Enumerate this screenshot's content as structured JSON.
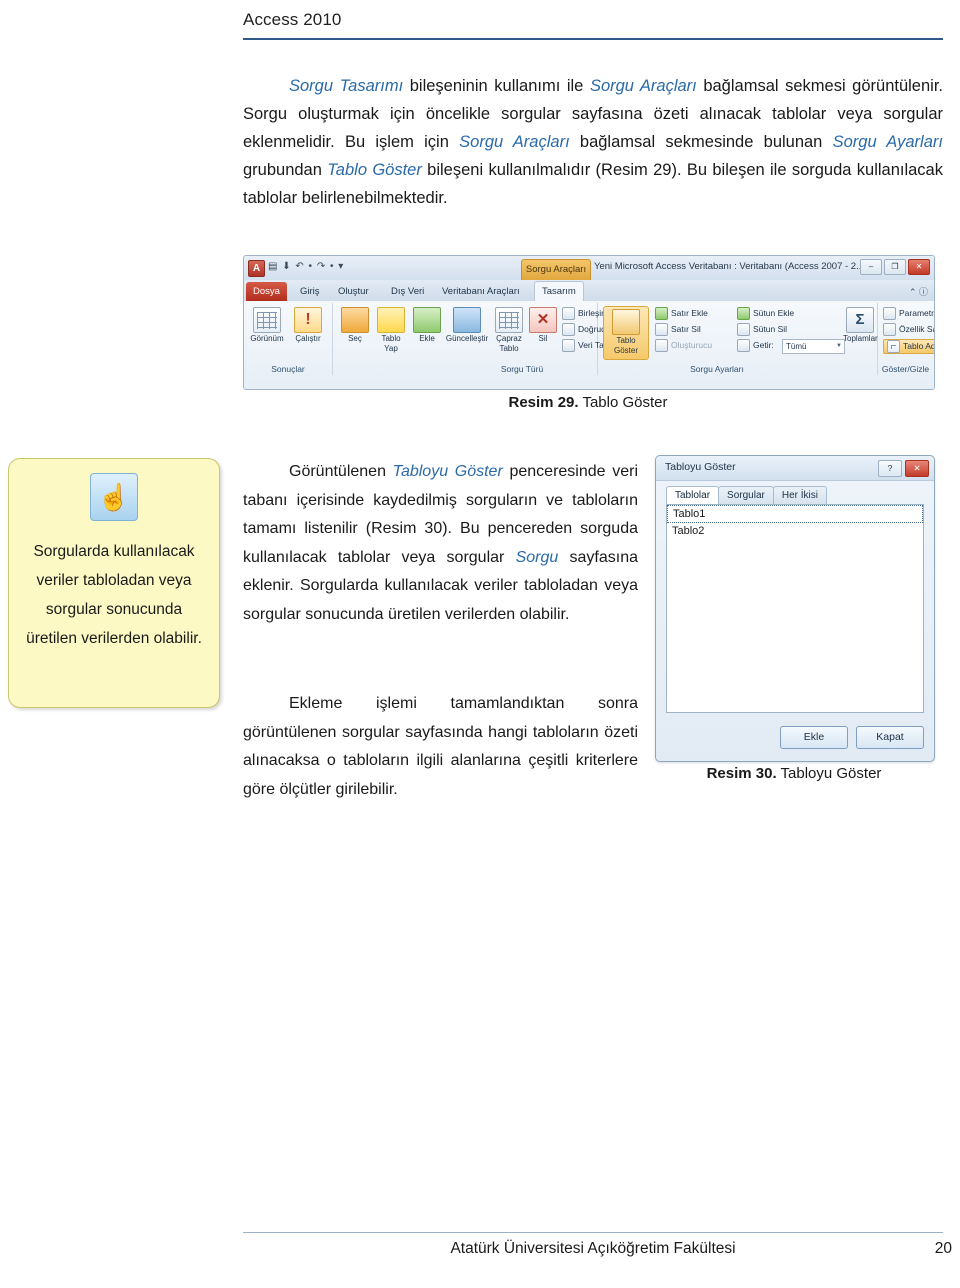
{
  "header": {
    "title": "Access 2010"
  },
  "body": {
    "p1_seg1": "Sorgu Tasarımı",
    "p1_seg2": " bileşeninin kullanımı ile ",
    "p1_seg3": "Sorgu Araçları",
    "p1_seg4": " bağlamsal sekmesi görüntülenir. Sorgu oluşturmak için öncelikle sorgular sayfasına özeti alınacak tablolar veya sorgular eklenmelidir. Bu işlem için ",
    "p1_seg5": "Sorgu Araçları",
    "p1_seg6": " bağlamsal sekmesinde bulunan ",
    "p1_seg7": "Sorgu Ayarları",
    "p1_seg8": " grubundan ",
    "p1_seg9": "Tablo Göster",
    "p1_seg10": " bileşeni kullanılmalıdır (Resim 29). Bu bileşen ile sorguda kullanılacak tablolar belirlenebilmektedir.",
    "p2_seg1": "Görüntülenen ",
    "p2_seg2": "Tabloyu Göster",
    "p2_seg3": " penceresinde veri tabanı içerisinde kaydedilmiş sorguların ve tabloların tamamı listenilir (Resim 30). Bu pencereden sorguda kullanılacak tablolar veya sorgular ",
    "p2_seg4": "Sorgu",
    "p2_seg5": " sayfasına eklenir. Sorgularda kullanılacak veriler tabloladan veya sorgular sonucunda üretilen verilerden olabilir.",
    "p3": "Ekleme işlemi tamamlandıktan sonra görüntülenen sorgular sayfasında hangi tabloların özeti alınacaksa o tabloların ilgili alanlarına çeşitli kriterlere göre ölçütler girilebilir."
  },
  "callout": {
    "icon": "hand-pointer-icon",
    "text": "Sorgularda kullanılacak veriler tabloladan veya sorgular sonucunda üretilen verilerden olabilir."
  },
  "figure29": {
    "caption_label": "Resim 29.",
    "caption_text": " Tablo Göster",
    "window": {
      "app_icon": "A",
      "quick_access": "▤ ⬇ ↶ • ↷ • ▾",
      "contextual_tab_group": "Sorgu Araçları",
      "doc_title": "Yeni Microsoft Access Veritabanı : Veritabanı (Access 2007 - 2...",
      "min": "–",
      "max": "❐",
      "close": "✕",
      "help": "⌃  ⓘ",
      "tabs": [
        "Dosya",
        "Giriş",
        "Oluştur",
        "Dış Veri",
        "Veritabanı Araçları",
        "Tasarım"
      ],
      "active_tab": "Tasarım",
      "groups": [
        {
          "label": "Sonuçlar",
          "buttons": [
            "Görünüm",
            "Çalıştır"
          ]
        },
        {
          "label": "Sorgu Türü",
          "buttons": [
            "Seç",
            "Tablo Yap",
            "Ekle",
            "Güncelleştir",
            "Çapraz Tablo",
            "Sil"
          ],
          "items": [
            "Birleşim",
            "Doğrudan",
            "Veri Tanımı"
          ]
        },
        {
          "label": "Sorgu Ayarları",
          "big_button": "Tablo Göster",
          "items": [
            "Satır Ekle",
            "Satır Sil",
            "Oluşturucu",
            "Sütun Ekle",
            "Sütun Sil",
            "Getir:"
          ],
          "combo_value": "Tümü",
          "totals_label": "Toplamlar",
          "sigma": "Σ"
        },
        {
          "label": "Göster/Gizle",
          "items": [
            "Parametreler",
            "Özellik Sayfası",
            "Tablo Adları"
          ]
        }
      ]
    }
  },
  "figure30": {
    "caption_label": "Resim 30.",
    "caption_text": " Tabloyu Göster",
    "dialog": {
      "title": "Tabloyu Göster",
      "help_btn": "?",
      "close_btn": "✕",
      "tabs": [
        "Tablolar",
        "Sorgular",
        "Her İkisi"
      ],
      "active_tab": "Tablolar",
      "list_items": [
        "Tablo1",
        "Tablo2"
      ],
      "selected_item": "Tablo1",
      "buttons": [
        "Ekle",
        "Kapat"
      ]
    }
  },
  "footer": {
    "text": "Atatürk Üniversitesi Açıköğretim Fakültesi",
    "page": "20"
  },
  "colors": {
    "accent_blue": "#2a6aa8",
    "rule": "#2e5a87",
    "callout_bg": "#fdf9c4",
    "callout_border": "#c9c76a"
  }
}
